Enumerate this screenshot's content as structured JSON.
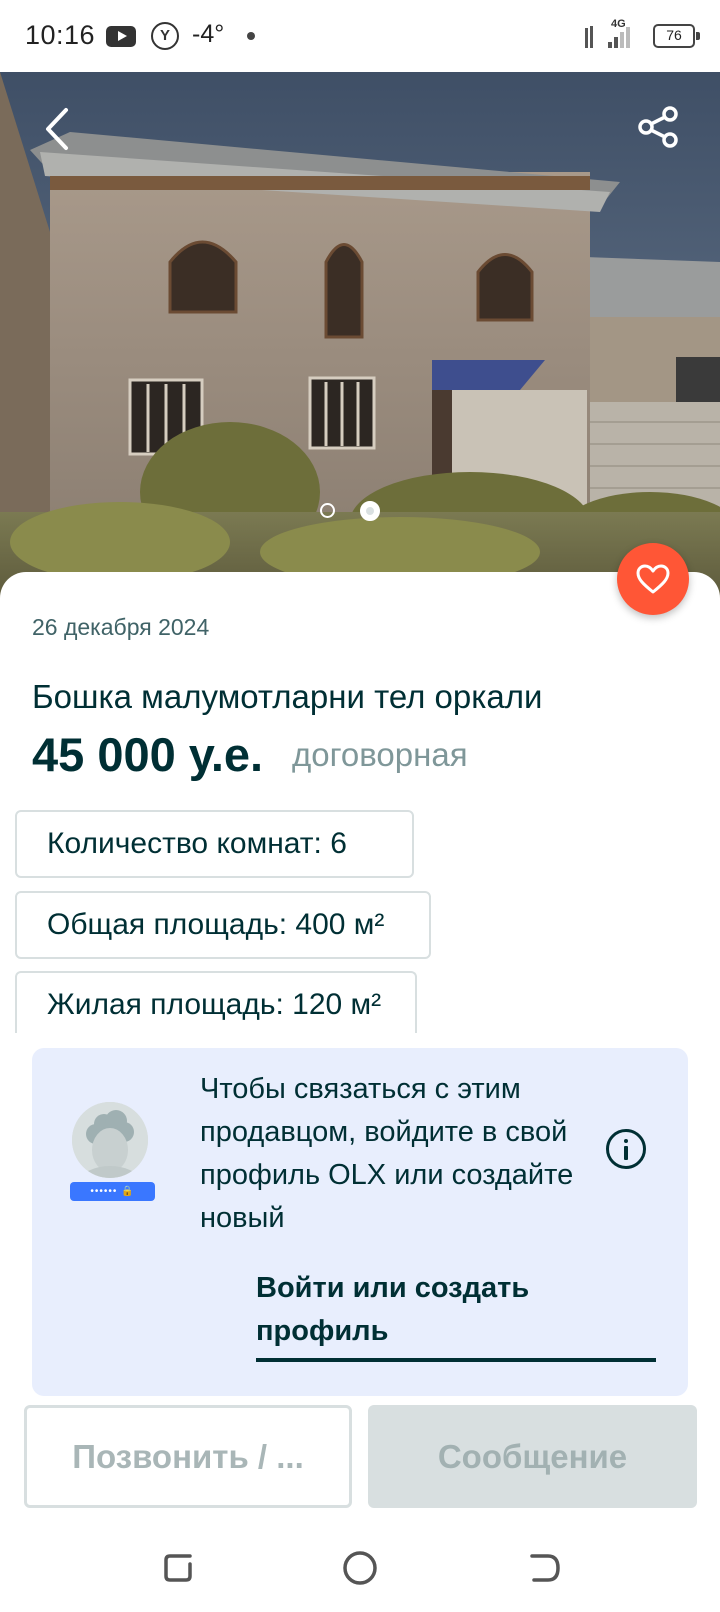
{
  "status_bar": {
    "time": "10:16",
    "temperature": "-4°",
    "network": "4G",
    "battery": "76"
  },
  "listing": {
    "date": "26 декабря 2024",
    "title": "Бошка малумотларни тел оркали",
    "price": "45 000 у.е.",
    "price_note": "договорная",
    "image_count": 2,
    "active_image": 2,
    "params": [
      "Количество комнат: 6",
      "Общая площадь: 400 м²",
      "Жилая площадь: 120 м²"
    ]
  },
  "login_prompt": {
    "text": "Чтобы связаться с этим продавцом, войдите в свой профиль OLX или создайте новый",
    "link": "Войти или создать профиль",
    "password_mask": "•••••• 🔒"
  },
  "actions": {
    "call_label": "Позвонить / ...",
    "message_label": "Сообщение"
  },
  "colors": {
    "primary": "#002f34",
    "favorite": "#ff5636",
    "login_bg": "#e8eefd",
    "disabled_text": "#a9b6b7",
    "muted": "#7f9799"
  }
}
